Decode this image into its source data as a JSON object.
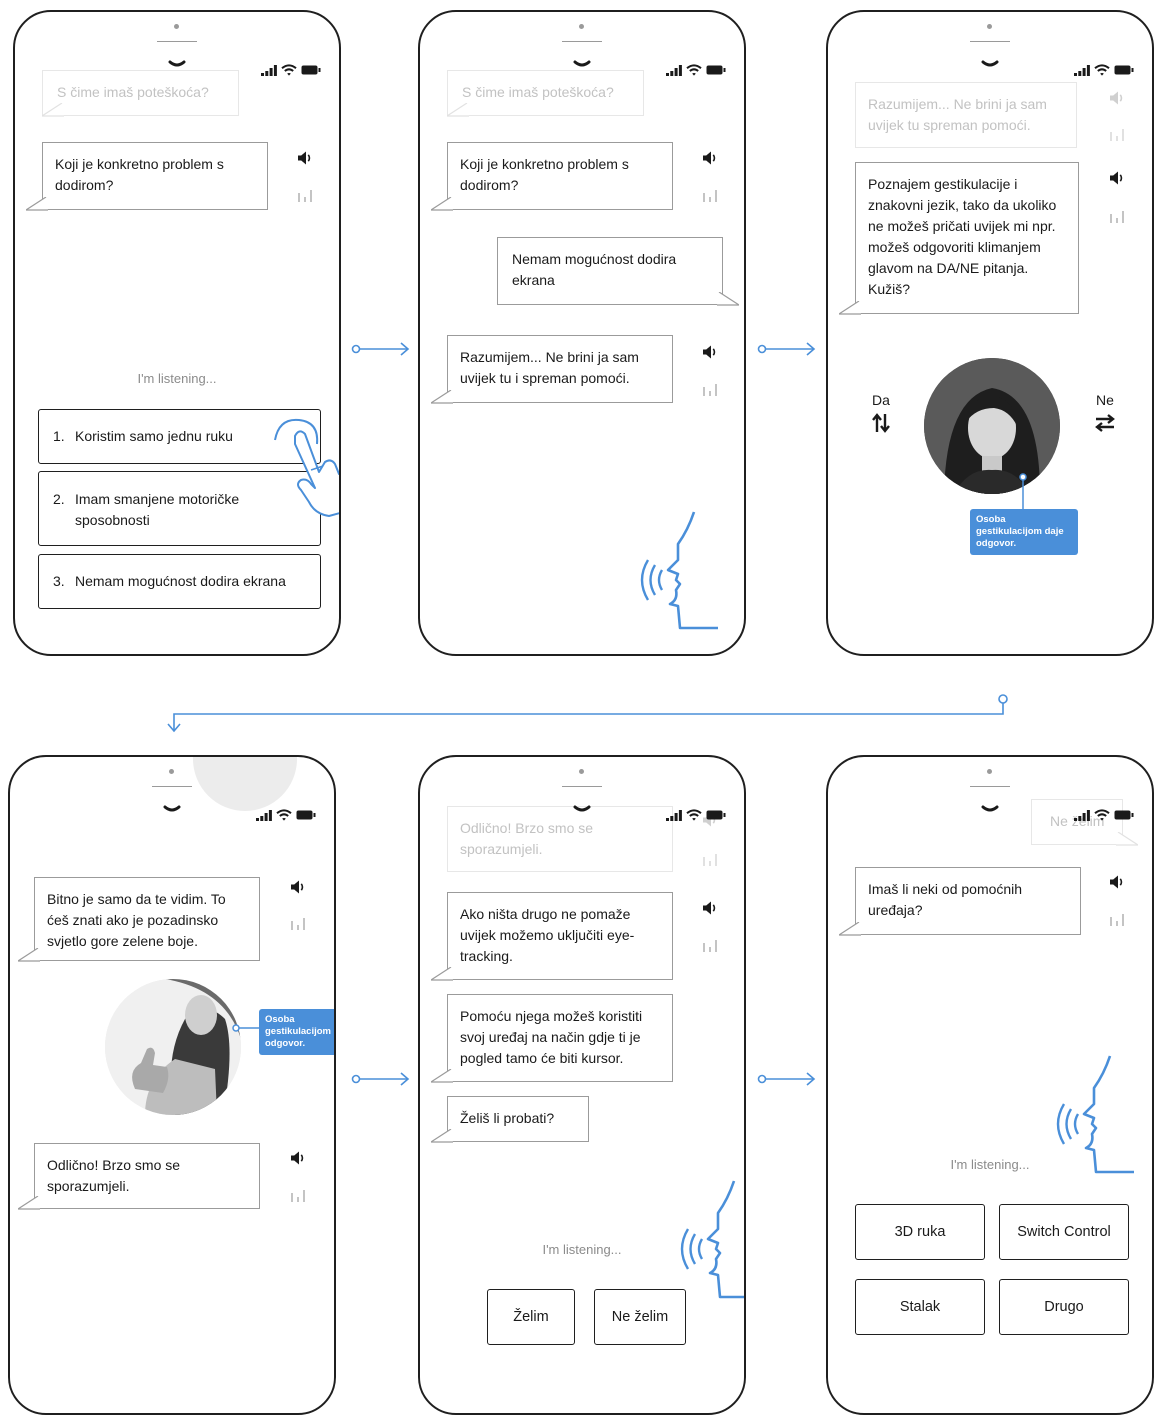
{
  "colors": {
    "accent": "#4a8fd9",
    "border": "#1f1f1f",
    "faded_text": "#c2c2c2"
  },
  "screen1": {
    "faded_prompt": "S čime imaš poteškoća?",
    "question": "Koji je konkretno problem s dodirom?",
    "listening": "I'm listening...",
    "options": [
      {
        "num": "1.",
        "label": "Koristim samo jednu ruku"
      },
      {
        "num": "2.",
        "label": "Imam smanjene motoričke sposobnosti"
      },
      {
        "num": "3.",
        "label": "Nemam mogućnost dodira ekrana"
      }
    ],
    "icons": [
      "speaker-icon",
      "equalizer-icon",
      "pointing-hand-icon"
    ]
  },
  "screen2": {
    "faded_prompt": "S čime imaš poteškoća?",
    "question": "Koji je konkretno problem s dodirom?",
    "user_reply": "Nemam mogućnost dodira ekrana",
    "answer": "Razumijem... Ne brini ja sam uvijek tu i spreman pomoći.",
    "icons": [
      "speaker-icon",
      "equalizer-icon",
      "speaking-face-icon"
    ]
  },
  "screen3": {
    "faded_message": "Razumijem... Ne brini ja sam uvijek tu spreman pomoći.",
    "message": "Poznajem gestikulacije i znakovni jezik, tako da ukoliko ne možeš pričati uvijek mi npr. možeš odgovoriti klimanjem glavom na DA/NE pitanja. Kužiš?",
    "yes_label": "Da",
    "no_label": "Ne",
    "tooltip": "Osoba gestikulacijom daje odgovor.",
    "icons": [
      "vertical-arrows-icon",
      "horizontal-arrows-icon",
      "woman-avatar"
    ]
  },
  "screen4": {
    "message1": "Bitno je samo da te vidim. To ćeš znati ako je pozadinsko svjetlo gore zelene boje.",
    "tooltip": "Osoba gestikulacijom daje odgovor.",
    "message2": "Odlično! Brzo smo se sporazumjeli.",
    "icons": [
      "thumbs-up-avatar",
      "speaker-icon",
      "equalizer-icon"
    ]
  },
  "screen5": {
    "faded_message": "Odlično! Brzo smo se sporazumjeli.",
    "message1": "Ako ništa drugo ne pomaže uvijek možemo uključiti eye-tracking.",
    "message2": "Pomoću njega možeš koristiti svoj uređaj na način gdje ti je pogled tamo će biti kursor.",
    "message3": "Želiš li probati?",
    "listening": "I'm listening...",
    "button_yes": "Želim",
    "button_no": "Ne želim"
  },
  "screen6": {
    "faded_reply": "Ne želim",
    "question": "Imaš li neki od pomoćnih uređaja?",
    "listening": "I'm listening...",
    "buttons": [
      "3D ruka",
      "Switch Control",
      "Stalak",
      "Drugo"
    ]
  }
}
